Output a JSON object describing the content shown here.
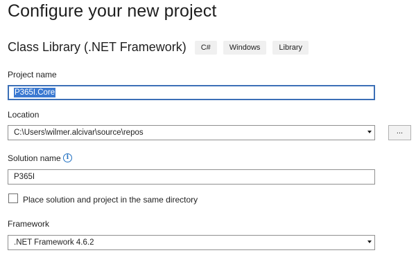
{
  "header": {
    "title": "Configure your new project",
    "project_type": "Class Library (.NET Framework)",
    "tags": [
      "C#",
      "Windows",
      "Library"
    ]
  },
  "form": {
    "project_name_label": "Project name",
    "project_name_value": "P365I.Core",
    "location_label": "Location",
    "location_value": "C:\\Users\\wilmer.alcivar\\source\\repos",
    "browse_label": "...",
    "solution_name_label": "Solution name",
    "solution_name_value": "P365I",
    "same_directory_label": "Place solution and project in the same directory",
    "same_directory_checked": false,
    "framework_label": "Framework",
    "framework_value": ".NET Framework 4.6.2"
  },
  "icons": {
    "solution_info": "info-icon",
    "combo_arrow": "chevron-down-icon"
  },
  "colors": {
    "accent": "#3b6fb6",
    "selection": "#3b79d1",
    "info": "#1f6fc1"
  }
}
